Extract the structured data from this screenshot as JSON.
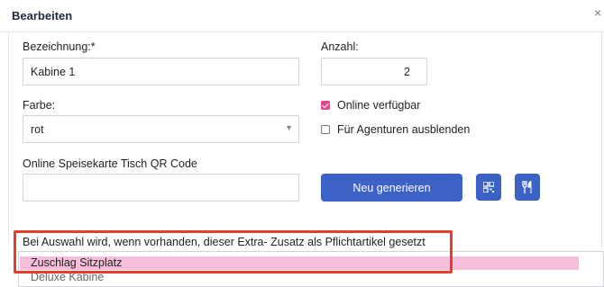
{
  "header": {
    "title": "Bearbeiten"
  },
  "form": {
    "bezeichnung": {
      "label": "Bezeichnung:*",
      "value": "Kabine 1"
    },
    "anzahl": {
      "label": "Anzahl:",
      "value": "2"
    },
    "farbe": {
      "label": "Farbe:",
      "value": "rot"
    },
    "online_verfuegbar": {
      "label": "Online verfügbar",
      "checked": true
    },
    "agenturen_ausblenden": {
      "label": "Für Agenturen ausblenden",
      "checked": false
    },
    "qr_code": {
      "label": "Online Speisekarte Tisch QR Code",
      "value": ""
    },
    "generate_button_label": "Neu generieren",
    "extra": {
      "label": "Bei Auswahl wird, wenn vorhanden, dieser Extra- Zusatz als Pflichtartikel gesetzt",
      "options": [
        "Zuschlag Sitzplatz",
        "Deluxe Kabine"
      ],
      "selected": "Zuschlag Sitzplatz"
    }
  },
  "icons": [
    "qr-code-icon",
    "cutlery-icon",
    "close-icon"
  ],
  "colors": {
    "accent": "#3b62c4",
    "check": "#e8458b",
    "highlight": "#e53e2b",
    "selected_option": "#f6bedb"
  }
}
